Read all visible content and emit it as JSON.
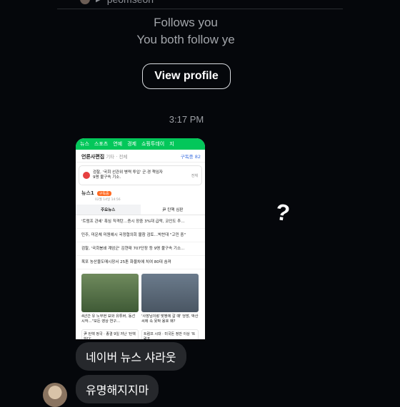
{
  "header": {
    "username": "peomseon"
  },
  "profile": {
    "follows_text": "Follows you",
    "mutual_text": "You both follow ye",
    "view_profile_label": "View profile"
  },
  "chat": {
    "timestamp": "3:17 PM",
    "reaction_glyph": "?",
    "messages": [
      "네이버 뉴스 샤라웃",
      "유명해지지마"
    ]
  },
  "shared_screenshot": {
    "tabs_top": [
      "뉴스",
      "스포츠",
      "연예",
      "경제",
      "쇼핑투데이",
      "지"
    ],
    "press_section": "언론사편집",
    "press_sub": "기타 · 전체",
    "subscribe_label": "구독중 82",
    "notice_title": "검찰, '국회 선관위 병력 투입' 군·경 책임자",
    "notice_sub": "9명 불구속 기소.",
    "notice_button": "전체",
    "press_name": "뉴스1",
    "press_badge": "구독중",
    "press_date": "02월 14일 14:56",
    "inner_tabs": [
      "주요뉴스",
      "尹 탄핵 심판"
    ],
    "headlines": [
      "'트럼프 관세' 폭심 직격탄…증시 장중 3%대 급락, 코인도 추…",
      "민주, 미운체 미원예시 국정협의회 불참 검토…박찬대 \"고민 중\"",
      "검찰, '국회봉쇄 계엄군' 김현태 707단장 등 9명 불구속 기소…",
      "목포 농산물도매시장서 25톤 화물차에 치여 80대 숨져"
    ],
    "photo_captions": [
      "4년간 유 노무현 묘와 유튜버, 동선 시작…\"모든 영상 연구…",
      "'사장님이랑 맞짱에 갈 때' 엉망, 박산 씨에 속 못박 용호 왜?"
    ],
    "bottom_cards": [
      "尹 탄핵 정국 · 종결 9일 저난 '탄핵 한다'",
      "트럼프 시대 · 미국돈 정반 이상 '트럼프"
    ]
  }
}
